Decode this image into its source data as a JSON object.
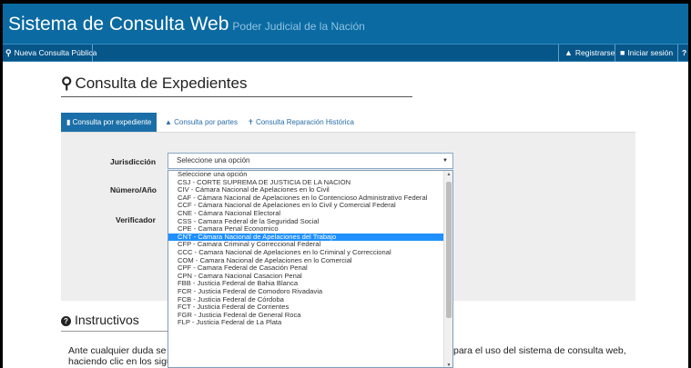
{
  "header": {
    "title": "Sistema de Consulta Web",
    "subtitle": "Poder Judicial de la Nación"
  },
  "nav": {
    "new_query": "Nueva Consulta Pública",
    "register": "Registrarse",
    "login": "Iniciar sesión",
    "help_icon": "?"
  },
  "page": {
    "title": "Consulta de Expedientes"
  },
  "tabs": [
    {
      "label": "Consulta por expediente",
      "active": true
    },
    {
      "label": "Consulta por partes",
      "active": false
    },
    {
      "label": "Consulta Reparación Histórica",
      "active": false
    }
  ],
  "form": {
    "jurisdiccion_label": "Jurisdicción",
    "numero_label": "Número/Año",
    "verificador_label": "Verificador",
    "select_value": "Seleccione una opción"
  },
  "dropdown": {
    "options": [
      "Seleccione una opción",
      "CSJ - CORTE SUPREMA DE JUSTICIA DE LA NACIÓN",
      "CIV - Cámara Nacional de Apelaciones en lo Civil",
      "CAF - Cámara Nacional de Apelaciones en lo Contencioso Administrativo Federal",
      "CCF - Cámara Nacional de Apelaciones en lo Civil y Comercial Federal",
      "CNE - Cámara Nacional Electoral",
      "CSS - Camara Federal de la Seguridad Social",
      "CPE - Camara Penal Economico",
      "CNT - Cámara Nacional de Apelaciones del Trabajo",
      "CFP - Camara Criminal y Correccional Federal",
      "CCC - Camara Nacional de Apelaciones en lo Criminal y Correccional",
      "COM - Camara Nacional de Apelaciones en lo Comercial",
      "CPF - Camara Federal de Casación Penal",
      "CPN - Camara Nacional Casacion Penal",
      "FBB - Justicia Federal de Bahia Blanca",
      "FCR - Justicia Federal de Comodoro Rivadavia",
      "FCB - Justicia Federal de Córdoba",
      "FCT - Justicia Federal de Corrientes",
      "FGR - Justicia Federal de General Roca",
      "FLP - Justicia Federal de La Plata"
    ],
    "highlighted_index": 8
  },
  "instructivos": {
    "title": "Instructivos",
    "line1_start": "Ante cualquier duda se r",
    "line1_end": "para el uso del sistema de consulta web,",
    "line2_start": "haciendo clic en los sigu"
  },
  "colors": {
    "header_bg": "#0a6aa1",
    "nav_bg": "#07568a",
    "tab_active": "#1b6fa8",
    "highlight": "#1e90ff"
  }
}
